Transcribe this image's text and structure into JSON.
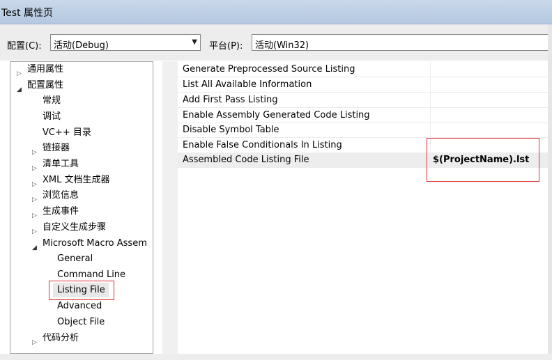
{
  "window": {
    "title": "Test 属性页"
  },
  "config": {
    "config_label": "配置(C):",
    "config_value": "活动(Debug)",
    "platform_label": "平台(P):",
    "platform_value": "活动(Win32)"
  },
  "tree": {
    "items": [
      {
        "label": "通用属性"
      },
      {
        "label": "配置属性"
      },
      {
        "label": "常规"
      },
      {
        "label": "调试"
      },
      {
        "label": "VC++ 目录"
      },
      {
        "label": "链接器"
      },
      {
        "label": "清单工具"
      },
      {
        "label": "XML 文档生成器"
      },
      {
        "label": "浏览信息"
      },
      {
        "label": "生成事件"
      },
      {
        "label": "自定义生成步骤"
      },
      {
        "label": "Microsoft Macro Assem"
      },
      {
        "label": "General"
      },
      {
        "label": "Command Line"
      },
      {
        "label": "Listing File"
      },
      {
        "label": "Advanced"
      },
      {
        "label": "Object File"
      },
      {
        "label": "代码分析"
      }
    ]
  },
  "properties": {
    "rows": [
      {
        "name": "Generate Preprocessed Source Listing",
        "value": ""
      },
      {
        "name": "List All Available Information",
        "value": ""
      },
      {
        "name": "Add First Pass Listing",
        "value": ""
      },
      {
        "name": "Enable Assembly Generated Code Listing",
        "value": ""
      },
      {
        "name": "Disable Symbol Table",
        "value": ""
      },
      {
        "name": "Enable False Conditionals In Listing",
        "value": ""
      },
      {
        "name": "Assembled Code Listing File",
        "value": "$(ProjectName).lst"
      }
    ]
  }
}
